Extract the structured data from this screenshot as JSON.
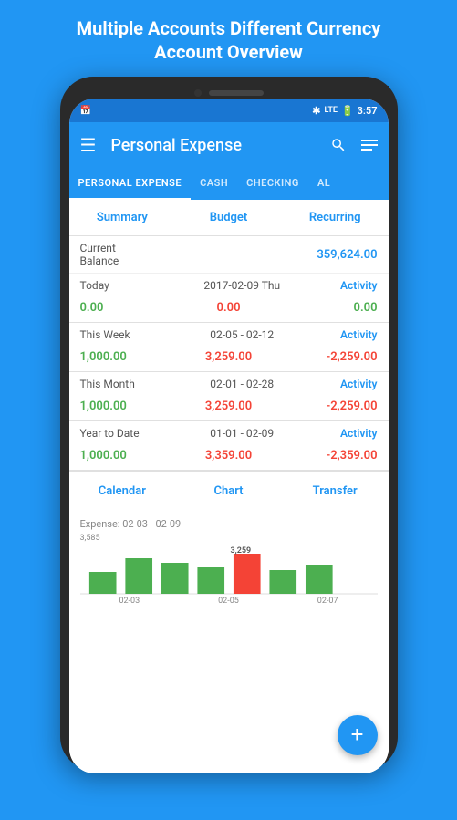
{
  "page": {
    "header": "Multiple Accounts Different Currency\nAccount Overview"
  },
  "status_bar": {
    "time": "3:57",
    "icons": [
      "bluetooth",
      "lte",
      "battery"
    ]
  },
  "app_bar": {
    "title": "Personal Expense",
    "menu_icon": "hamburger",
    "search_icon": "search",
    "filter_icon": "list"
  },
  "tabs": [
    {
      "label": "PERSONAL EXPENSE",
      "active": true
    },
    {
      "label": "CASH",
      "active": false
    },
    {
      "label": "CHECKING",
      "active": false
    },
    {
      "label": "AL",
      "active": false
    }
  ],
  "summary_tabs": [
    {
      "label": "Summary"
    },
    {
      "label": "Budget"
    },
    {
      "label": "Recurring"
    }
  ],
  "current_balance": {
    "label": "Current Balance",
    "value": "359,624.00",
    "color": "#2196F3"
  },
  "periods": [
    {
      "label": "Today",
      "date": "2017-02-09 Thu",
      "activity": "Activity",
      "income": "0.00",
      "expense": "0.00",
      "net": "0.00"
    },
    {
      "label": "This Week",
      "date": "02-05 - 02-12",
      "activity": "Activity",
      "income": "1,000.00",
      "expense": "3,259.00",
      "net": "-2,259.00"
    },
    {
      "label": "This Month",
      "date": "02-01 - 02-28",
      "activity": "Activity",
      "income": "1,000.00",
      "expense": "3,259.00",
      "net": "-2,259.00"
    },
    {
      "label": "Year to Date",
      "date": "01-01 - 02-09",
      "activity": "Activity",
      "income": "1,000.00",
      "expense": "3,359.00",
      "net": "-2,359.00"
    }
  ],
  "bottom_actions": [
    {
      "label": "Calendar"
    },
    {
      "label": "Chart"
    },
    {
      "label": "Transfer"
    }
  ],
  "chart": {
    "label": "Expense: 02-03 - 02-09",
    "y_value": "3,585",
    "x_labels": [
      "02-03",
      "02-05",
      "02-07"
    ],
    "bar_value": "3,259"
  },
  "fab": {
    "label": "+"
  }
}
